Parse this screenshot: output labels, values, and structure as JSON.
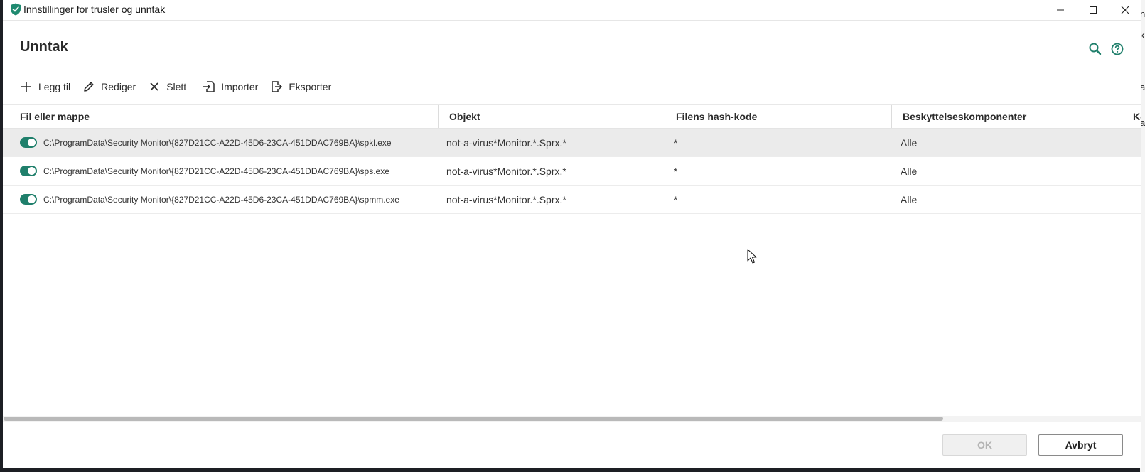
{
  "window": {
    "title": "Innstillinger for trusler og unntak",
    "controls": [
      "minimize-icon",
      "maximize-icon",
      "close-icon"
    ]
  },
  "header": {
    "title": "Unntak",
    "icons": [
      "search-icon",
      "help-icon"
    ]
  },
  "toolbar": {
    "add_label": "Legg til",
    "edit_label": "Rediger",
    "delete_label": "Slett",
    "import_label": "Importer",
    "export_label": "Eksporter"
  },
  "table": {
    "columns": [
      "Fil eller mappe",
      "Objekt",
      "Filens hash-kode",
      "Beskyttelseskomponenter",
      "Ko"
    ],
    "rows": [
      {
        "enabled": true,
        "path": "C:\\ProgramData\\Security Monitor\\{827D21CC-A22D-45D6-23CA-451DDAC769BA}\\spkl.exe",
        "object": "not-a-virus*Monitor.*.Sprx.*",
        "hash": "*",
        "components": "Alle",
        "selected": true
      },
      {
        "enabled": true,
        "path": "C:\\ProgramData\\Security Monitor\\{827D21CC-A22D-45D6-23CA-451DDAC769BA}\\sps.exe",
        "object": "not-a-virus*Monitor.*.Sprx.*",
        "hash": "*",
        "components": "Alle",
        "selected": false
      },
      {
        "enabled": true,
        "path": "C:\\ProgramData\\Security Monitor\\{827D21CC-A22D-45D6-23CA-451DDAC769BA}\\spmm.exe",
        "object": "not-a-virus*Monitor.*.Sprx.*",
        "hash": "*",
        "components": "Alle",
        "selected": false
      }
    ]
  },
  "footer": {
    "ok_label": "OK",
    "cancel_label": "Avbryt",
    "ok_disabled": true
  },
  "right_edge_peek": [
    "n",
    "k",
    "a",
    "a"
  ],
  "colors": {
    "accent": "#1f7f6b",
    "selected_row": "#ebebeb",
    "scroll_thumb": "#b9b9b9"
  }
}
